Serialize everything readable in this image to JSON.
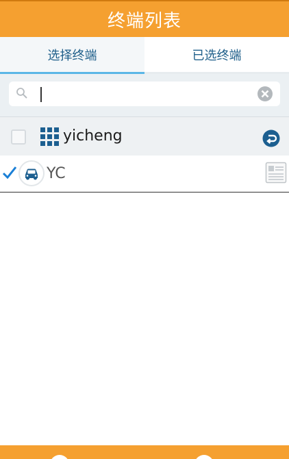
{
  "header": {
    "title": "终端列表"
  },
  "tabs": [
    {
      "label": "选择终端",
      "active": true
    },
    {
      "label": "已选终端",
      "active": false
    }
  ],
  "search": {
    "value": "",
    "placeholder": ""
  },
  "group": {
    "name": "yicheng",
    "checked": false
  },
  "terminal": {
    "name": "YC",
    "checked": true
  },
  "icons": {
    "search": "search-icon",
    "clear": "clear-icon",
    "group": "grid-icon",
    "back": "back-icon",
    "vehicle": "car-icon",
    "detail": "document-icon",
    "checkmark": "checkmark-icon"
  },
  "colors": {
    "accent": "#f5a030",
    "tab_indicator": "#5ab6e6",
    "tab_text": "#1f5f8a",
    "icon_blue": "#1c5f90"
  }
}
